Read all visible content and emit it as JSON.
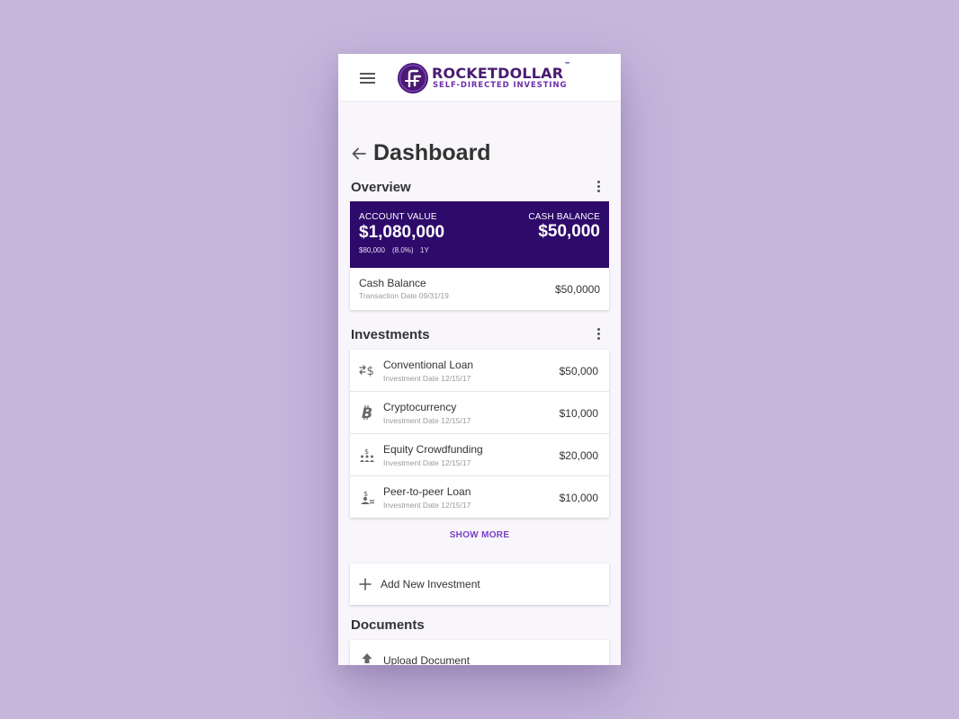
{
  "header": {
    "brand_name": "ROCKETDOLLAR",
    "brand_tm": "™",
    "brand_tagline": "SELF-DIRECTED INVESTING",
    "menu_icon": "hamburger-menu-icon",
    "logo_icon": "rocketdollar-logo-icon",
    "colors": {
      "brand": "#4a1a72",
      "tagline": "#6b2fa8"
    }
  },
  "page": {
    "title": "Dashboard",
    "back_icon": "arrow-left-icon"
  },
  "overview": {
    "section_title": "Overview",
    "account_value_label": "ACCOUNT VALUE",
    "account_value": "$1,080,000",
    "change_amount": "$80,000",
    "change_percent": "(8.0%)",
    "period": "1Y",
    "cash_balance_label": "CASH BALANCE",
    "cash_balance_value": "$50,000",
    "hero_color": "#2e0a6a",
    "cash_row": {
      "title": "Cash Balance",
      "subtitle": "Transaction Date 09/31/19",
      "amount": "$50,0000"
    }
  },
  "investments": {
    "section_title": "Investments",
    "items": [
      {
        "title": "Conventional Loan",
        "subtitle": "Investment Date 12/15/17",
        "amount": "$50,000",
        "icon": "exchange-dollar-icon"
      },
      {
        "title": "Cryptocurrency",
        "subtitle": "Investment Date 12/15/17",
        "amount": "$10,000",
        "icon": "bitcoin-icon"
      },
      {
        "title": "Equity Crowdfunding",
        "subtitle": "Investment Date 12/15/17",
        "amount": "$20,000",
        "icon": "crowd-dollar-icon"
      },
      {
        "title": "Peer-to-peer Loan",
        "subtitle": "Investment Date 12/15/17",
        "amount": "$10,000",
        "icon": "person-dollar-icon"
      }
    ],
    "show_more_label": "SHOW MORE",
    "add_new_label": "Add New Investment",
    "add_icon": "plus-icon",
    "accent_color": "#7a3fc3"
  },
  "documents": {
    "section_title": "Documents",
    "upload_label": "Upload Document",
    "upload_icon": "upload-arrow-icon"
  }
}
